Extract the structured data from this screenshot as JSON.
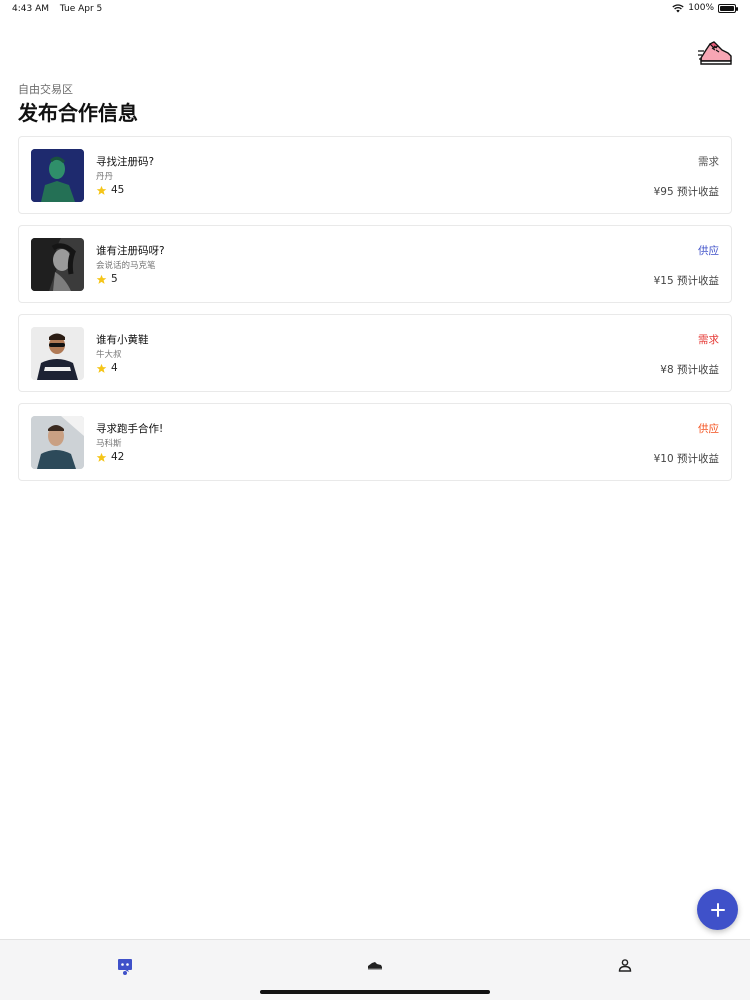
{
  "status_bar": {
    "time": "4:43 AM",
    "date": "Tue Apr 5",
    "battery": "100%"
  },
  "header": {
    "subtitle": "自由交易区",
    "title": "发布合作信息"
  },
  "colors": {
    "accent": "#3f51c9",
    "demand_gray": "#555555",
    "supply_blue": "#3f51c9",
    "demand_red": "#e53935",
    "supply_orange": "#f4511e",
    "star": "#f5c518"
  },
  "cards": [
    {
      "name": "寻找注册码?",
      "author": "丹丹",
      "rating": "45",
      "type": "需求",
      "type_color": "#555555",
      "income": "¥95 预计收益",
      "avatar_bg": "#1e2a6e"
    },
    {
      "name": "谁有注册码呀?",
      "author": "会说话的马克笔",
      "rating": "5",
      "type": "供应",
      "type_color": "#3f51c9",
      "income": "¥15 预计收益",
      "avatar_bg": "#5a5a5a"
    },
    {
      "name": "谁有小黄鞋",
      "author": "牛大叔",
      "rating": "4",
      "type": "需求",
      "type_color": "#e53935",
      "income": "¥8 预计收益",
      "avatar_bg": "#e8e8e8"
    },
    {
      "name": "寻求跑手合作!",
      "author": "马科斯",
      "rating": "42",
      "type": "供应",
      "type_color": "#f4511e",
      "income": "¥10 预计收益",
      "avatar_bg": "#c9cfd4"
    }
  ],
  "tabs": [
    {
      "name": "discord-icon",
      "active": true
    },
    {
      "name": "sneaker-icon",
      "active": false
    },
    {
      "name": "person-icon",
      "active": false
    }
  ]
}
